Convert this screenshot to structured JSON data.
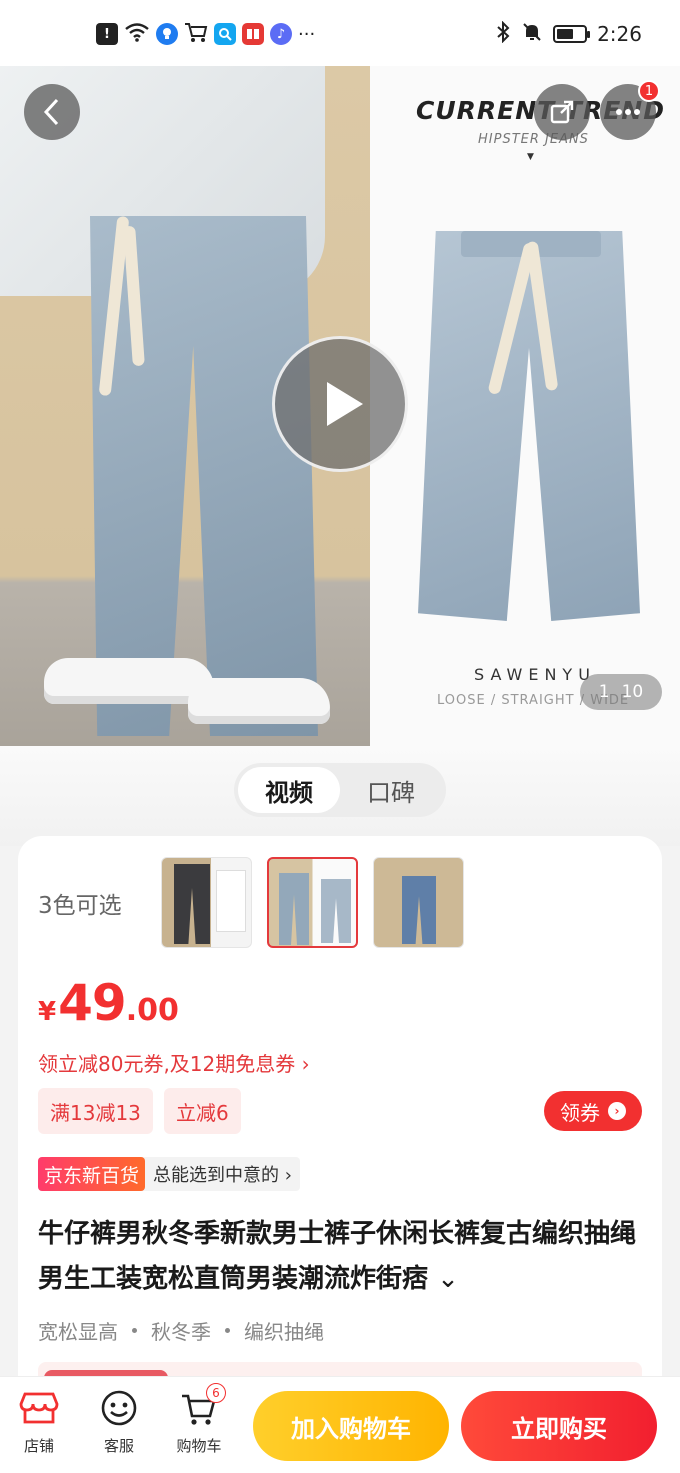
{
  "status_bar": {
    "time": "2:26",
    "icons": [
      "alert-icon",
      "wifi-icon",
      "bulb-app-icon",
      "cart-app-icon",
      "search-app-icon",
      "book-app-icon",
      "music-app-icon",
      "more-dots-icon"
    ],
    "right_icons": [
      "bluetooth-icon",
      "mute-icon",
      "battery-icon"
    ],
    "more_text": "···",
    "battery_level": 0.6
  },
  "hero": {
    "brand_title": "CURRENT TREND",
    "brand_subtitle": "HIPSTER JEANS",
    "label_line_1": "SAWENYU",
    "label_line_2": "LOOSE / STRAIGHT / WIDE",
    "share_badge_count": "1",
    "pager_current": "1",
    "pager_total": "10",
    "back_icon": "‹",
    "share_icon": "↗"
  },
  "media_tabs": [
    "视频",
    "口碑"
  ],
  "product": {
    "color_count_label": "3色可选",
    "thumbnails": [
      "black-jeans-thumb",
      "light-blue-jeans-thumb",
      "blue-jeans-thumb"
    ],
    "price": {
      "currency": "¥",
      "integer": "49",
      "decimal": ".00"
    },
    "coupon_line": "领立减80元券,及12期免息券 ›",
    "tags": [
      "满13减13",
      "立减6"
    ],
    "get_coupon_label": "领券",
    "jd_badge": "京东新百货",
    "jd_text": "总能选到中意的 ›",
    "title": "牛仔裤男秋冬季新款男士裤子休闲长裤复古编织抽绳男生工装宽松直筒男装潮流炸街痞",
    "title_expand_icon": "⌄",
    "features": [
      "宽松显高",
      "秋冬季",
      "编织抽绳"
    ]
  },
  "bottom_bar": {
    "nav": [
      {
        "label": "店铺",
        "icon": "store-icon"
      },
      {
        "label": "客服",
        "icon": "customer-service-icon"
      },
      {
        "label": "购物车",
        "icon": "cart-icon",
        "badge": "6"
      }
    ],
    "add_to_cart": "加入购物车",
    "buy_now": "立即购买"
  },
  "colors": {
    "accent_red": "#f23030",
    "accent_yellow": "#ffc20e"
  }
}
